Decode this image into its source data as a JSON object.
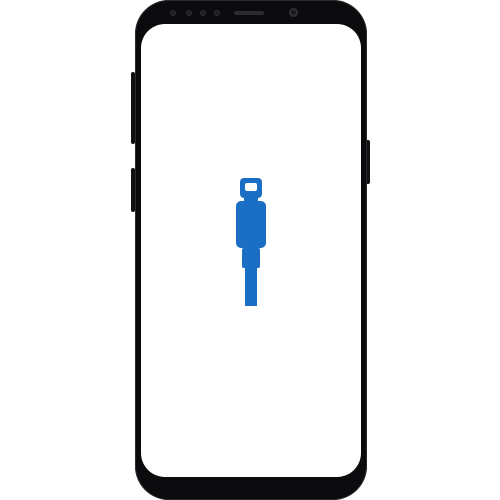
{
  "device": {
    "model": "smartphone",
    "body_color": "#0b0b0d",
    "screen_color": "#ffffff"
  },
  "screen": {
    "icon": "lightning-cable-icon",
    "icon_color": "#1a6ec4"
  }
}
